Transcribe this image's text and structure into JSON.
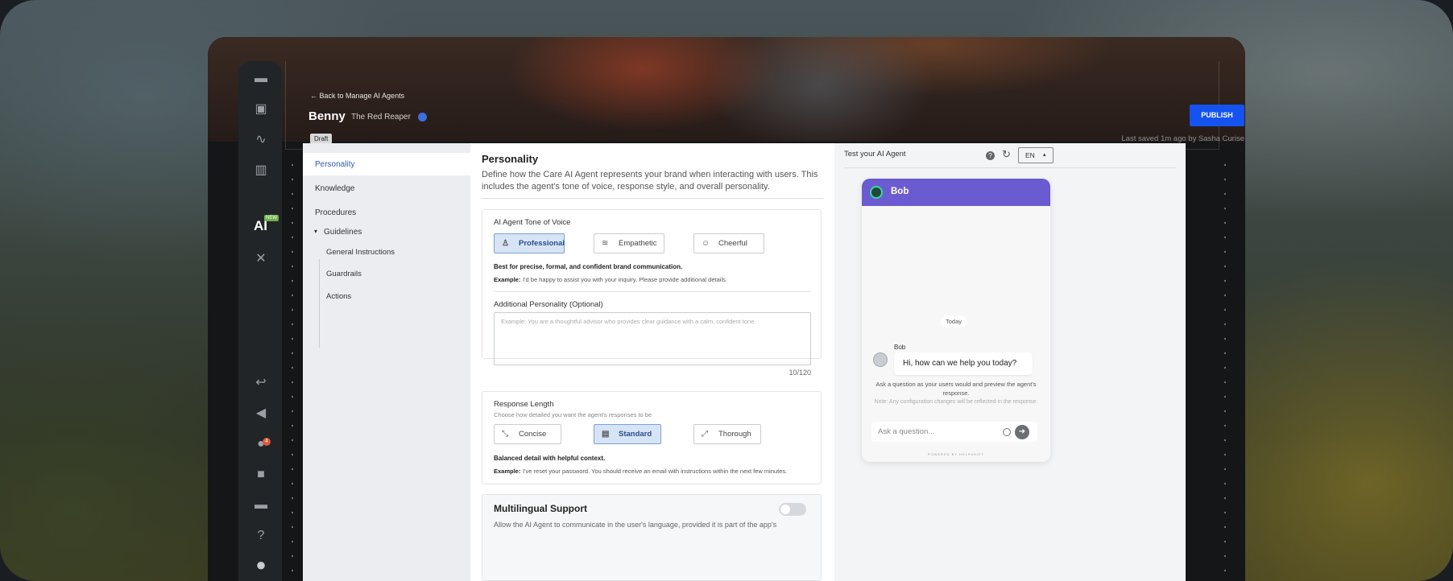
{
  "header": {
    "back_link": "← Back to Manage AI Agents",
    "agent_name": "Benny",
    "agent_subtitle": "The Red Reaper",
    "status_badge": "Draft",
    "publish_label": "PUBLISH",
    "last_saved": "Last saved 1m ago by Sasha Curise"
  },
  "rail": {
    "ai_label": "AI",
    "new_badge": "NEW",
    "notification_count": "4"
  },
  "nav": {
    "items": [
      {
        "label": "Personality"
      },
      {
        "label": "Knowledge"
      },
      {
        "label": "Procedures"
      },
      {
        "label": "Guidelines"
      },
      {
        "label": "General Instructions"
      },
      {
        "label": "Guardrails"
      },
      {
        "label": "Actions"
      }
    ]
  },
  "personality": {
    "title": "Personality",
    "description": "Define how the Care AI Agent represents your brand when interacting with users. This includes the agent's tone of voice, response style, and overall personality.",
    "tone": {
      "label": "AI Agent Tone of Voice",
      "options": [
        "Professional",
        "Empathetic",
        "Cheerful"
      ],
      "selected": "Professional",
      "summary": "Best for precise, formal, and confident brand communication.",
      "example_label": "Example:",
      "example_text": "I'd be happy to assist you with your inquiry. Please provide additional details."
    },
    "additional": {
      "label": "Additional Personality (Optional)",
      "placeholder": "Example: You are a thoughtful advisor who provides clear guidance with a calm, confident tone.",
      "counter": "10/120"
    },
    "response_length": {
      "label": "Response Length",
      "sublabel": "Choose how detailed you want the agent's responses to be",
      "options": [
        "Concise",
        "Standard",
        "Thorough"
      ],
      "selected": "Standard",
      "summary": "Balanced detail with helpful context.",
      "example_label": "Example:",
      "example_text": "I've reset your password. You should receive an email with instructions within the next few minutes."
    },
    "multilingual": {
      "label": "Multilingual Support",
      "description": "Allow the AI Agent to communicate in the user's language, provided it is part of the app's",
      "enabled": false
    }
  },
  "test_panel": {
    "title": "Test your AI Agent",
    "language": "EN",
    "chat": {
      "bot_name": "Bob",
      "date_divider": "Today",
      "sender": "Bob",
      "message": "Hi, how can we help you today?",
      "hint": "Ask a question as your users would and preview the agent's response.",
      "note": "Note: Any configuration changes will be reflected in the response.",
      "input_placeholder": "Ask a question...",
      "powered_by": "POWERED BY HELPSHIFT"
    }
  },
  "colors": {
    "accent": "#1453f0",
    "chat_header": "#6b5bd0",
    "selected_option_bg": "#d7e4f6"
  }
}
